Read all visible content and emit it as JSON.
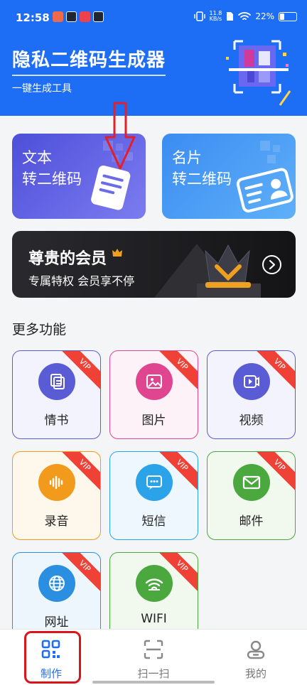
{
  "status": {
    "time": "12:58",
    "net_speed": "11.8",
    "net_unit": "KB/s",
    "battery": "22%"
  },
  "header": {
    "title": "隐私二维码生成器",
    "subtitle": "一键生成工具"
  },
  "cards": {
    "text": {
      "line1": "文本",
      "line2": "转二维码"
    },
    "card": {
      "line1": "名片",
      "line2": "转二维码"
    }
  },
  "vip": {
    "title": "尊贵的会员",
    "subtitle": "专属特权 会员享不停"
  },
  "section": {
    "title": "更多功能"
  },
  "tiles": [
    {
      "label": "情书",
      "icon": "document-stack-icon",
      "color": "#5a5cd6",
      "bg": "#f3f3fd"
    },
    {
      "label": "图片",
      "icon": "image-icon",
      "color": "#e0458f",
      "bg": "#fcf2f8"
    },
    {
      "label": "视频",
      "icon": "video-icon",
      "color": "#5a5cd6",
      "bg": "#f3f3fd"
    },
    {
      "label": "录音",
      "icon": "audio-wave-icon",
      "color": "#f29a1c",
      "bg": "#fdf7ec"
    },
    {
      "label": "短信",
      "icon": "message-icon",
      "color": "#2aa3e8",
      "bg": "#edf7fd"
    },
    {
      "label": "邮件",
      "icon": "mail-icon",
      "color": "#4aa83e",
      "bg": "#f1f9ef"
    },
    {
      "label": "网址",
      "icon": "globe-icon",
      "color": "#2a8fe0",
      "bg": "#edf6fd"
    },
    {
      "label": "WIFI",
      "icon": "wifi-icon",
      "color": "#4aa83e",
      "bg": "#f1f9ef"
    }
  ],
  "ribbon": "VIP",
  "tabs": [
    {
      "label": "制作",
      "active": true
    },
    {
      "label": "扫一扫",
      "active": false
    },
    {
      "label": "我的",
      "active": false
    }
  ],
  "colors": {
    "primary": "#1e6ef5",
    "highlight": "#d9151b"
  }
}
